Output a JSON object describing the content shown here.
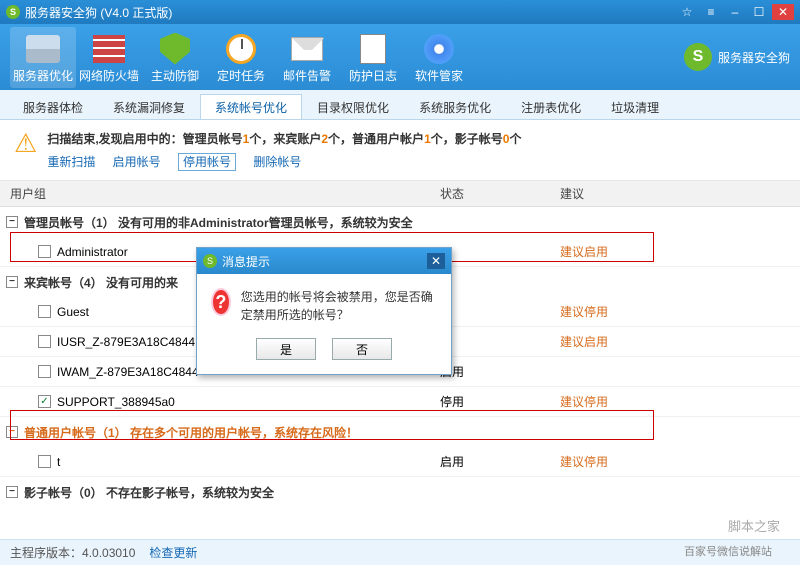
{
  "window": {
    "title": "服务器安全狗 (V4.0 正式版)"
  },
  "winbtns": {
    "star": "☆",
    "menu": "≡",
    "min": "–",
    "max": "☐",
    "close": "✕"
  },
  "toolbar": [
    {
      "label": "服务器优化",
      "icon": "srv"
    },
    {
      "label": "网络防火墙",
      "icon": "fw"
    },
    {
      "label": "主动防御",
      "icon": "shield"
    },
    {
      "label": "定时任务",
      "icon": "clock"
    },
    {
      "label": "邮件告警",
      "icon": "mail"
    },
    {
      "label": "防护日志",
      "icon": "log"
    },
    {
      "label": "软件管家",
      "icon": "disc"
    }
  ],
  "brand": "服务器安全狗",
  "tabs": [
    "服务器体检",
    "系统漏洞修复",
    "系统帐号优化",
    "目录权限优化",
    "系统服务优化",
    "注册表优化",
    "垃圾清理"
  ],
  "active_tab": 2,
  "summary": {
    "text_prefix": "扫描结束,发现启用中的：管理员帐号",
    "n1": "1",
    "t1": "个，来宾账户",
    "n2": "2",
    "t2": "个，普通用户帐户",
    "n3": "1",
    "t3": "个，影子帐号",
    "n4": "0",
    "t4": "个"
  },
  "actions": {
    "rescan": "重新扫描",
    "enable": "启用帐号",
    "disable": "停用帐号",
    "delete": "删除帐号"
  },
  "columns": {
    "group": "用户组",
    "status": "状态",
    "suggest": "建议"
  },
  "groups": [
    {
      "title": "管理员帐号（1）  没有可用的非Administrator管理员帐号，系统较为安全",
      "expanded": true,
      "warn": false,
      "rows": [
        {
          "name": "Administrator",
          "status": "",
          "suggest": "建议启用",
          "checked": false
        }
      ]
    },
    {
      "title": "来宾帐号（4）  没有可用的来",
      "expanded": true,
      "warn": false,
      "rows": [
        {
          "name": "Guest",
          "status": "",
          "suggest": "建议停用",
          "checked": false
        },
        {
          "name": "IUSR_Z-879E3A18C4844",
          "status": "",
          "suggest": "建议启用",
          "checked": false
        },
        {
          "name": "IWAM_Z-879E3A18C4844",
          "status": "启用",
          "suggest": "",
          "checked": false
        },
        {
          "name": "SUPPORT_388945a0",
          "status": "停用",
          "suggest": "建议停用",
          "checked": true
        }
      ]
    },
    {
      "title": "普通用户帐号（1）  存在多个可用的用户帐号，系统存在风险！",
      "expanded": true,
      "warn": true,
      "rows": [
        {
          "name": "t",
          "status": "启用",
          "suggest": "建议停用",
          "checked": false
        }
      ]
    },
    {
      "title": "影子帐号（0）  不存在影子帐号，系统较为安全",
      "expanded": true,
      "warn": false,
      "rows": []
    }
  ],
  "dialog": {
    "title": "消息提示",
    "message": "您选用的帐号将会被禁用，您是否确定禁用所选的帐号？",
    "yes": "是",
    "no": "否"
  },
  "statusbar": {
    "ver_label": "主程序版本：",
    "ver": "4.0.03010",
    "update": "检查更新"
  },
  "wm1": "脚本之家",
  "wm2": "百家号微信说解站"
}
